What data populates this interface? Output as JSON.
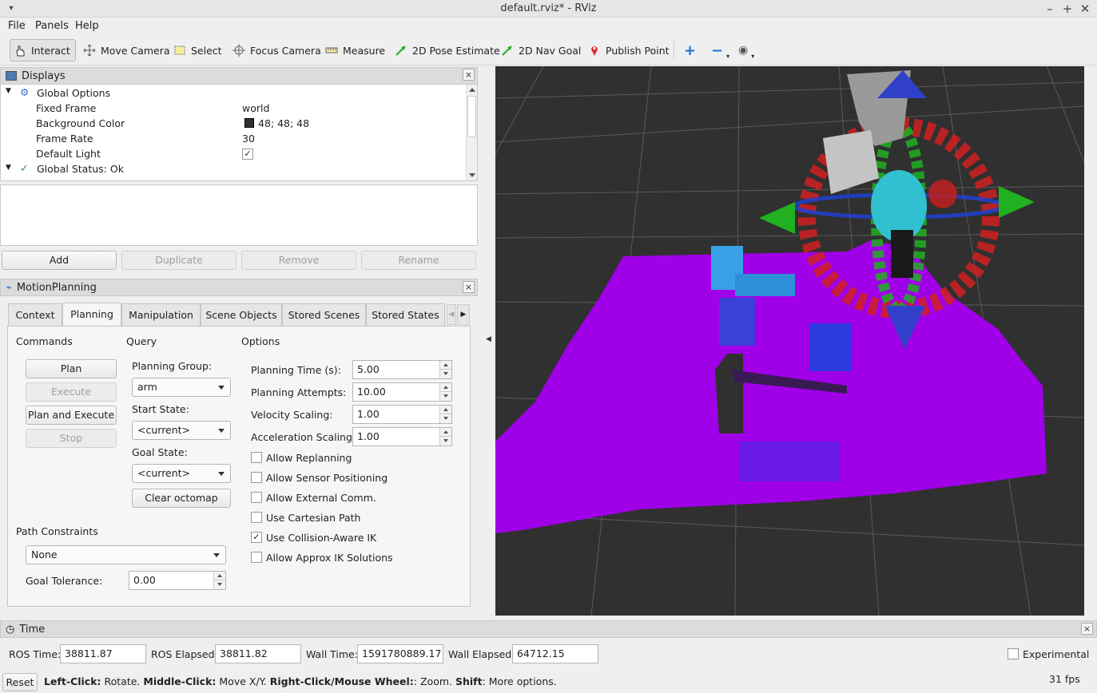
{
  "window": {
    "title": "default.rviz* - RViz"
  },
  "menu": {
    "file": "File",
    "panels": "Panels",
    "help": "Help"
  },
  "toolbar": {
    "interact": "Interact",
    "move_camera": "Move Camera",
    "select": "Select",
    "focus_camera": "Focus Camera",
    "measure": "Measure",
    "pose_estimate": "2D Pose Estimate",
    "nav_goal": "2D Nav Goal",
    "publish_point": "Publish Point"
  },
  "displays": {
    "title": "Displays",
    "global_options": "Global Options",
    "rows": [
      {
        "name": "Fixed Frame",
        "value": "world"
      },
      {
        "name": "Background Color",
        "value": "48; 48; 48"
      },
      {
        "name": "Frame Rate",
        "value": "30"
      },
      {
        "name": "Default Light",
        "value": ""
      }
    ],
    "global_status": "Global Status: Ok",
    "buttons": {
      "add": "Add",
      "duplicate": "Duplicate",
      "remove": "Remove",
      "rename": "Rename"
    }
  },
  "motion": {
    "title": "MotionPlanning",
    "tabs": [
      "Context",
      "Planning",
      "Manipulation",
      "Scene Objects",
      "Stored Scenes",
      "Stored States"
    ],
    "commands": {
      "heading": "Commands",
      "plan": "Plan",
      "execute": "Execute",
      "plan_execute": "Plan and Execute",
      "stop": "Stop"
    },
    "query": {
      "heading": "Query",
      "planning_group_label": "Planning Group:",
      "planning_group": "arm",
      "start_state_label": "Start State:",
      "start_state": "<current>",
      "goal_state_label": "Goal State:",
      "goal_state": "<current>",
      "clear_octomap": "Clear octomap"
    },
    "options": {
      "heading": "Options",
      "planning_time_label": "Planning Time (s):",
      "planning_time": "5.00",
      "planning_attempts_label": "Planning Attempts:",
      "planning_attempts": "10.00",
      "velocity_label": "Velocity Scaling:",
      "velocity": "1.00",
      "accel_label": "Acceleration Scaling:",
      "accel": "1.00",
      "checks": [
        {
          "label": "Allow Replanning",
          "checked": false
        },
        {
          "label": "Allow Sensor Positioning",
          "checked": false
        },
        {
          "label": "Allow External Comm.",
          "checked": false
        },
        {
          "label": "Use Cartesian Path",
          "checked": false
        },
        {
          "label": "Use Collision-Aware IK",
          "checked": true
        },
        {
          "label": "Allow Approx IK Solutions",
          "checked": false
        }
      ]
    },
    "path_constraints_label": "Path Constraints",
    "path_constraints": "None",
    "goal_tolerance_label": "Goal Tolerance:",
    "goal_tolerance": "0.00"
  },
  "time": {
    "title": "Time",
    "ros_time_label": "ROS Time:",
    "ros_time": "38811.87",
    "ros_elapsed_label": "ROS Elapsed:",
    "ros_elapsed": "38811.82",
    "wall_time_label": "Wall Time:",
    "wall_time": "1591780889.17",
    "wall_elapsed_label": "Wall Elapsed:",
    "wall_elapsed": "64712.15",
    "experimental": "Experimental"
  },
  "status": {
    "reset": "Reset",
    "left_click": "Left-Click:",
    "left_text": " Rotate. ",
    "middle_click": "Middle-Click:",
    "middle_text": " Move X/Y. ",
    "right_click": "Right-Click/Mouse Wheel:",
    "right_text": ": Zoom. ",
    "shift": "Shift",
    "shift_text": ": More options.",
    "fps": "31 fps"
  },
  "colors": {
    "viewport_bg": "#303030",
    "octomap": "#a000e8",
    "accent_blue": "#1a73d0"
  }
}
